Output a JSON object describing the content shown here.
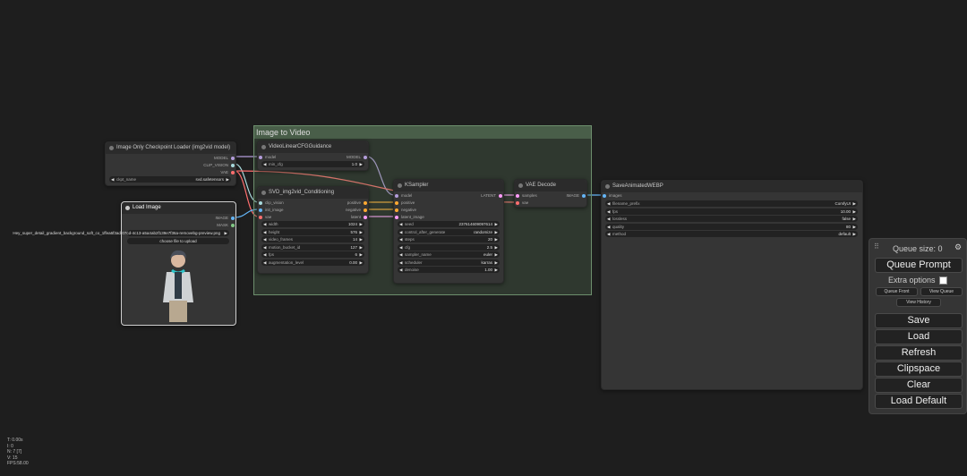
{
  "group": {
    "title": "Image to Video"
  },
  "checkpoint": {
    "title": "Image Only Checkpoint Loader (img2vid model)",
    "outputs": [
      "MODEL",
      "CLIP_VISION",
      "VAE"
    ],
    "widget_label": "ckpt_name",
    "widget_value": "svd.safetensors"
  },
  "load_image": {
    "title": "Load Image",
    "outputs": [
      "IMAGE",
      "MASK"
    ],
    "filename": "Hey_super_detail_gradient_background_soft_co_1ffea6f3ad-07cd-4c13-a5a4ab2f139e7f36a-removebg-preview.png",
    "upload_label": "choose file to upload"
  },
  "video_linear": {
    "title": "VideoLinearCFGGuidance",
    "input": "model",
    "output": "MODEL",
    "widget_label": "min_cfg",
    "widget_value": "1.0"
  },
  "svd_cond": {
    "title": "SVD_img2vid_Conditioning",
    "inputs": [
      "clip_vision",
      "init_image",
      "vae"
    ],
    "outputs": [
      "positive",
      "negative",
      "latent"
    ],
    "widgets": [
      {
        "label": "width",
        "value": "1024"
      },
      {
        "label": "height",
        "value": "576"
      },
      {
        "label": "video_frames",
        "value": "14"
      },
      {
        "label": "motion_bucket_id",
        "value": "127"
      },
      {
        "label": "fps",
        "value": "6"
      },
      {
        "label": "augmentation_level",
        "value": "0.00"
      }
    ]
  },
  "ksampler": {
    "title": "KSampler",
    "inputs": [
      "model",
      "positive",
      "negative",
      "latent_image"
    ],
    "output": "LATENT",
    "widgets": [
      {
        "label": "seed",
        "value": "237614609097614"
      },
      {
        "label": "control_after_generate",
        "value": "randomize"
      },
      {
        "label": "steps",
        "value": "20"
      },
      {
        "label": "cfg",
        "value": "2.5"
      },
      {
        "label": "sampler_name",
        "value": "euler"
      },
      {
        "label": "scheduler",
        "value": "karras"
      },
      {
        "label": "denoise",
        "value": "1.00"
      }
    ]
  },
  "vae_decode": {
    "title": "VAE Decode",
    "inputs": [
      "samples",
      "vae"
    ],
    "output": "IMAGE"
  },
  "save_webp": {
    "title": "SaveAnimatedWEBP",
    "input": "images",
    "widgets": [
      {
        "label": "filename_prefix",
        "value": "ComfyUI"
      },
      {
        "label": "fps",
        "value": "10.00"
      },
      {
        "label": "lossless",
        "value": "false"
      },
      {
        "label": "quality",
        "value": "80"
      },
      {
        "label": "method",
        "value": "default"
      }
    ]
  },
  "queue_panel": {
    "queue_size": "Queue size: 0",
    "queue_prompt": "Queue Prompt",
    "extra_options": "Extra options",
    "queue_front": "Queue Front",
    "view_queue": "View Queue",
    "view_history": "View History",
    "buttons": [
      "Save",
      "Load",
      "Refresh",
      "Clipspace",
      "Clear",
      "Load Default"
    ]
  },
  "stats": [
    "T: 0.00s",
    "I: 0",
    "N: 7 [7]",
    "V: 15",
    "FPS:58.00"
  ],
  "colors": {
    "model_link": "#b39ddb",
    "clip_vision_link": "#a8dadc",
    "vae_link": "#ff6e6e",
    "image_link": "#64b5f6",
    "conditioning_link": "#ffa931",
    "latent_link": "#ff9cf9"
  }
}
